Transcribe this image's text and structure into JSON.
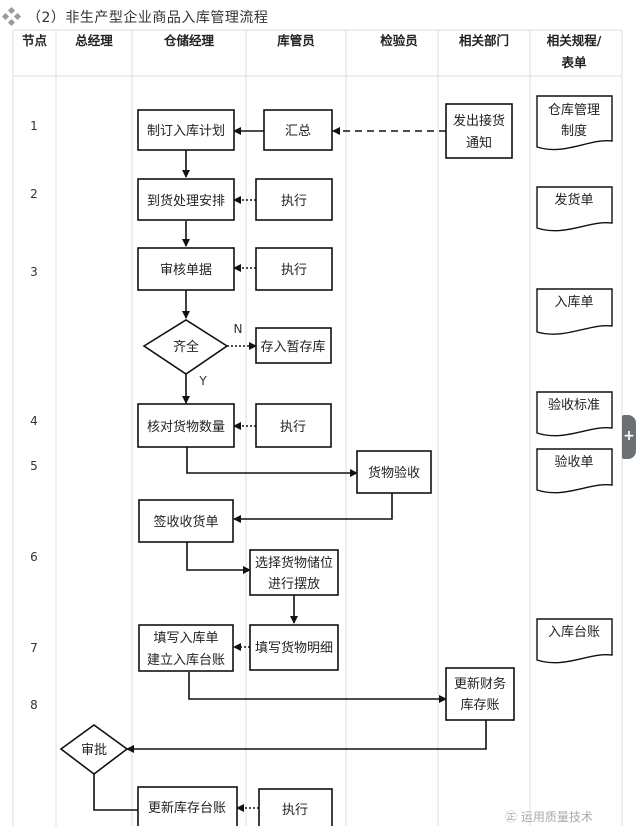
{
  "title": "（2）非生产型企业商品入库管理流程",
  "lanes": [
    {
      "id": "node",
      "label": "节点"
    },
    {
      "id": "gm",
      "label": "总经理"
    },
    {
      "id": "wm",
      "label": "仓储经理"
    },
    {
      "id": "keeper",
      "label": "库管员"
    },
    {
      "id": "inspector",
      "label": "检验员"
    },
    {
      "id": "dept",
      "label": "相关部门"
    },
    {
      "id": "docs",
      "label": "相关规程/表单"
    }
  ],
  "steps": [
    "1",
    "2",
    "3",
    "4",
    "5",
    "6",
    "7",
    "8"
  ],
  "nodes": {
    "plan": "制订入库计划",
    "summary": "汇总",
    "notice": "发出接货通知",
    "arrange": "到货处理安排",
    "exec1": "执行",
    "review": "审核单据",
    "exec2": "执行",
    "complete": "齐全",
    "temp_store": "存入暂存库",
    "check_qty": "核对货物数量",
    "exec3": "执行",
    "inspect": "货物验收",
    "sign": "签收收货单",
    "select_loc": "选择货物储位进行摆放",
    "fill_detail": "填写货物明细",
    "fill_form": "填写入库单建立入库台账",
    "update_fin": "更新财务库存账",
    "approve": "审批",
    "update_ledger": "更新库存台账",
    "exec4": "执行"
  },
  "branch_labels": {
    "no": "N",
    "yes": "Y"
  },
  "documents": {
    "doc1": "仓库管理制度",
    "doc2": "发货单",
    "doc3": "入库单",
    "doc4": "验收标准",
    "doc5": "验收单",
    "doc6": "入库台账"
  },
  "side_tab": {
    "icon": "plus-icon",
    "label": "+"
  },
  "watermark": "㊣ 运用质量技术"
}
